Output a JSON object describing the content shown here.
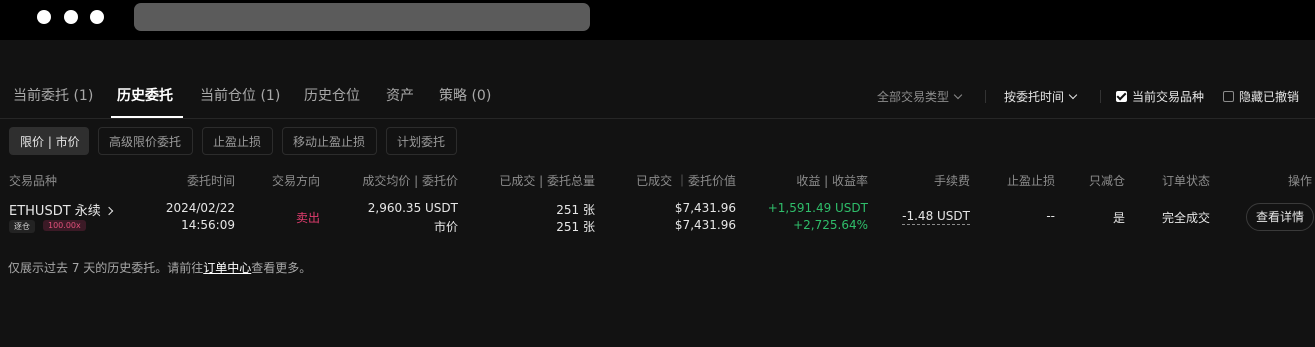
{
  "tabs": [
    {
      "label": "当前委托 (1)",
      "active": false
    },
    {
      "label": "历史委托",
      "active": true
    },
    {
      "label": "当前仓位 (1)",
      "active": false
    },
    {
      "label": "历史仓位",
      "active": false
    },
    {
      "label": "资产",
      "active": false
    },
    {
      "label": "策略 (0)",
      "active": false
    }
  ],
  "filters": {
    "trade_type": "全部交易类型",
    "sort_by": "按委托时间",
    "current_symbol": {
      "label": "当前交易品种",
      "checked": true
    },
    "hide_cancelled": {
      "label": "隐藏已撤销",
      "checked": false
    }
  },
  "order_types": [
    {
      "label": "限价 | 市价",
      "active": true
    },
    {
      "label": "高级限价委托",
      "active": false
    },
    {
      "label": "止盈止损",
      "active": false
    },
    {
      "label": "移动止盈止损",
      "active": false
    },
    {
      "label": "计划委托",
      "active": false
    }
  ],
  "columns": {
    "symbol": "交易品种",
    "time": "委托时间",
    "side": "交易方向",
    "price": "成交均价 | 委托价",
    "amount": "已成交 | 委托总量",
    "value": "已成交 ｜委托价值",
    "pnl": "收益 | 收益率",
    "fee": "手续费",
    "tpsl": "止盈止损",
    "reduce_only": "只减仓",
    "status": "订单状态",
    "action": "操作"
  },
  "order": {
    "symbol": "ETHUSDT 永续",
    "margin_mode": "逐仓",
    "leverage": "100.00x",
    "date": "2024/02/22",
    "time": "14:56:09",
    "side": "卖出",
    "avg_price": "2,960.35 USDT",
    "order_price": "市价",
    "filled_qty": "251 张",
    "total_qty": "251 张",
    "filled_value": "$7,431.96",
    "total_value": "$7,431.96",
    "pnl": "+1,591.49 USDT",
    "pnl_rate": "+2,725.64%",
    "fee": "-1.48 USDT",
    "tpsl": "--",
    "reduce_only": "是",
    "status": "完全成交",
    "action": "查看详情"
  },
  "note": {
    "prefix": "仅展示过去 7 天的历史委托。请前往",
    "link": "订单中心",
    "suffix": "查看更多。"
  }
}
